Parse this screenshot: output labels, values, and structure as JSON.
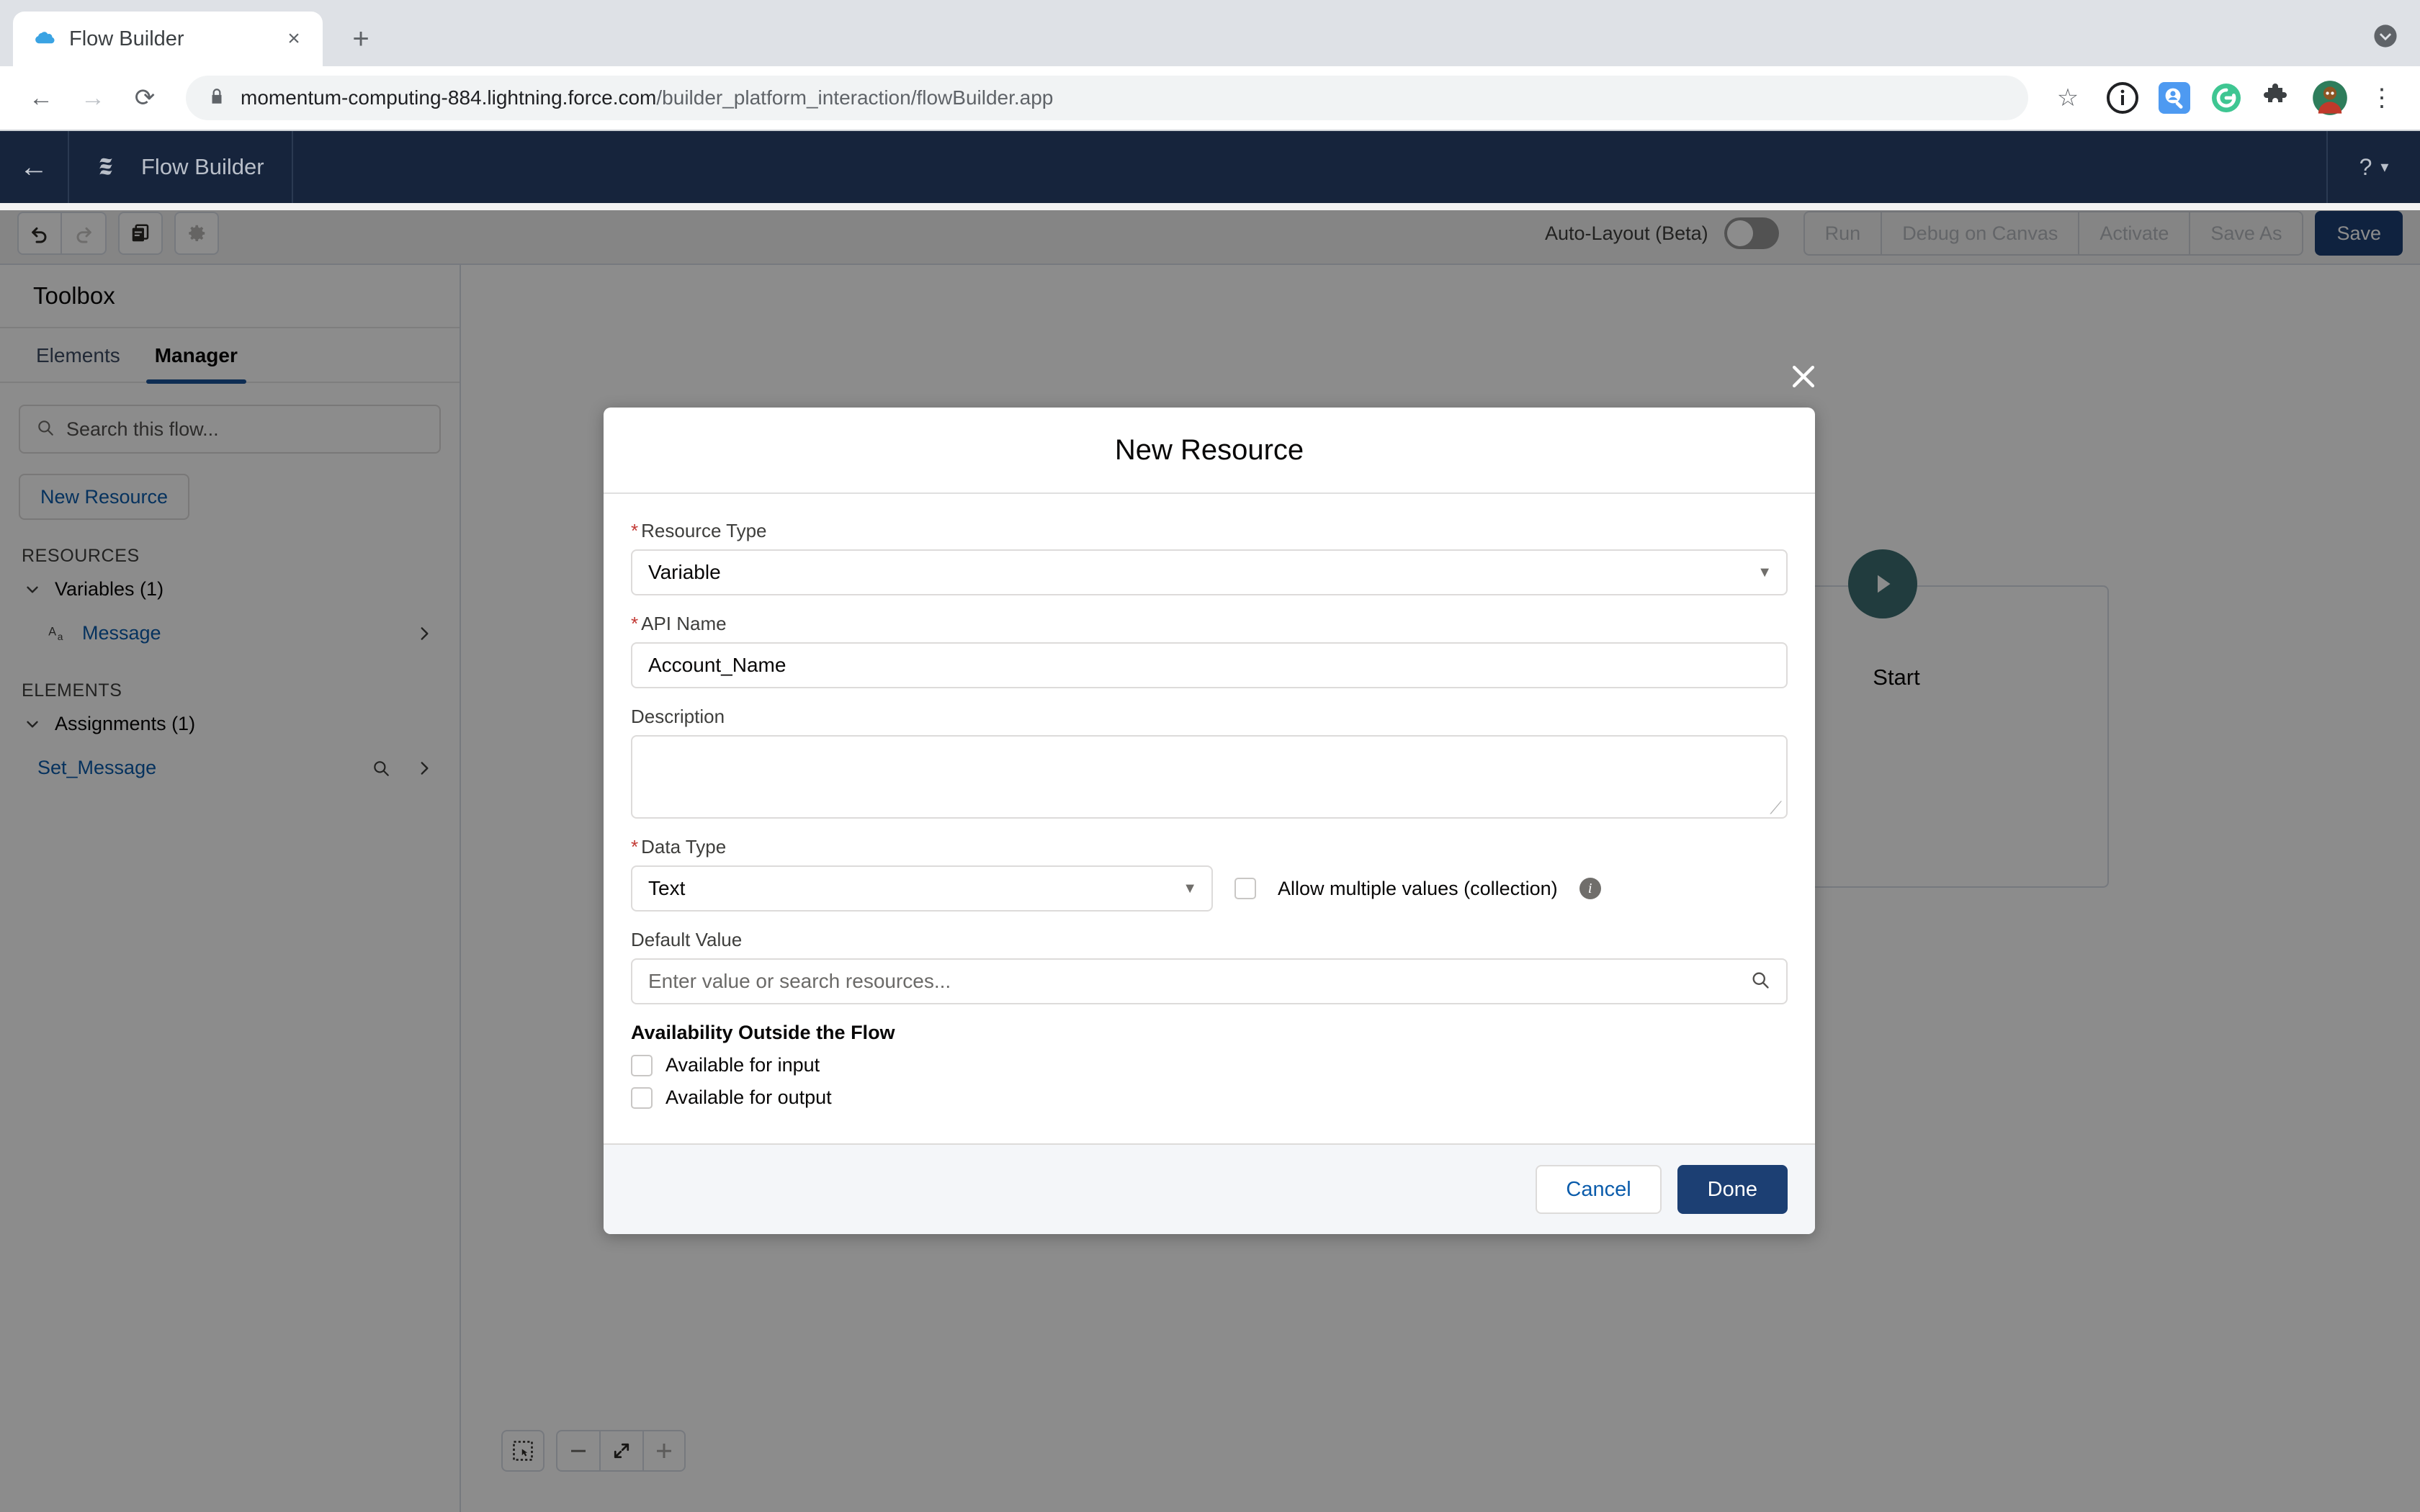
{
  "browser": {
    "tab": {
      "title": "Flow Builder",
      "favicon": "salesforce-cloud-icon",
      "close": "×"
    },
    "newtab_label": "+",
    "url": "momentum-computing-884.lightning.force.com",
    "url_path": "/builder_platform_interaction/flowBuilder.app",
    "nav": {
      "back": "←",
      "forward": "→",
      "reload": "⟳"
    },
    "extensions": [
      "info-circle-icon",
      "search-person-icon",
      "grammarly-icon",
      "puzzle-extension-icon",
      "profile-avatar"
    ],
    "menu": "⋮",
    "star": "☆"
  },
  "sf_header": {
    "back_arrow": "←",
    "app_name": "Flow Builder",
    "help": "?",
    "help_caret": "▾"
  },
  "toolbar": {
    "undo": "undo-icon",
    "redo": "redo-icon",
    "duplicate": "duplicate-icon",
    "settings": "gear-icon",
    "autolayout_label": "Auto-Layout (Beta)",
    "autolayout_on": false,
    "buttons": [
      "Run",
      "Debug on Canvas",
      "Activate",
      "Save As"
    ],
    "save_label": "Save"
  },
  "toolbox": {
    "title": "Toolbox",
    "tabs": [
      {
        "label": "Elements",
        "active": false
      },
      {
        "label": "Manager",
        "active": true
      }
    ],
    "search_placeholder": "Search this flow...",
    "new_resource_label": "New Resource",
    "resources_header": "RESOURCES",
    "resources_group": "Variables (1)",
    "resource_item": "Message",
    "resource_item_type_icon": "text-type-icon",
    "elements_header": "ELEMENTS",
    "elements_group": "Assignments (1)",
    "element_item": "Set_Message"
  },
  "canvas": {
    "start_label": "Start",
    "start_icon": "play-icon",
    "zoom_controls": [
      "select-mode-icon",
      "zoom-out-icon",
      "zoom-fit-icon",
      "zoom-in-icon"
    ]
  },
  "modal": {
    "close": "✕",
    "title": "New Resource",
    "resource_type": {
      "label": "Resource Type",
      "required": true,
      "value": "Variable"
    },
    "api_name": {
      "label": "API Name",
      "required": true,
      "value": "Account_Name"
    },
    "description": {
      "label": "Description",
      "value": ""
    },
    "data_type": {
      "label": "Data Type",
      "required": true,
      "value": "Text"
    },
    "allow_multiple": {
      "label": "Allow multiple values (collection)",
      "checked": false,
      "info": "i"
    },
    "default_value": {
      "label": "Default Value",
      "placeholder": "Enter value or search resources...",
      "value": ""
    },
    "availability_title": "Availability Outside the Flow",
    "available_input": {
      "label": "Available for input",
      "checked": false
    },
    "available_output": {
      "label": "Available for output",
      "checked": false
    },
    "cancel_label": "Cancel",
    "done_label": "Done"
  }
}
